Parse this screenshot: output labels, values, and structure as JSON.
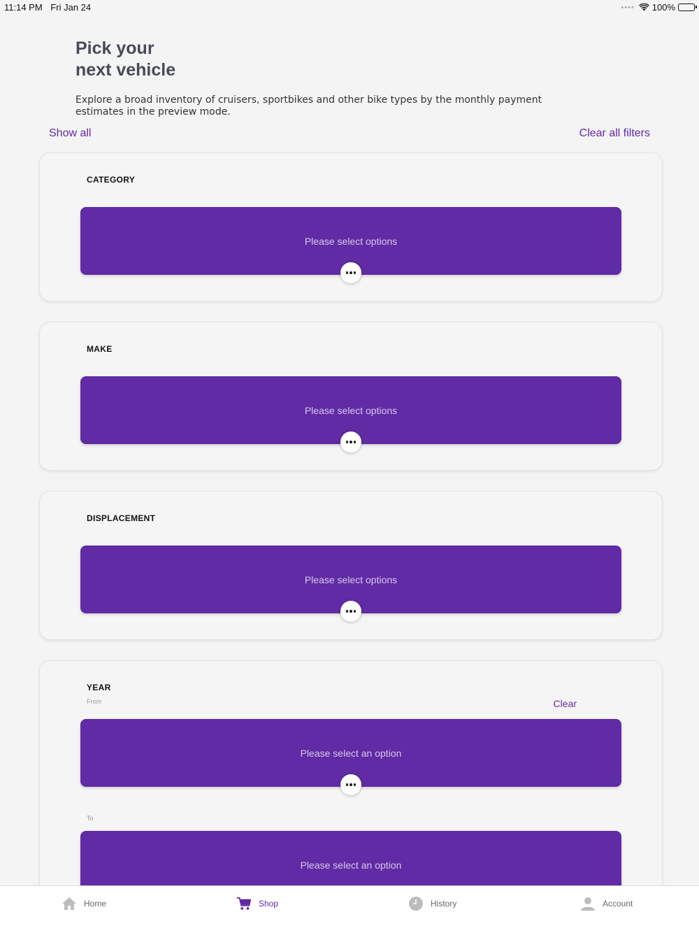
{
  "status_bar": {
    "time": "11:14 PM",
    "date": "Fri Jan 24",
    "battery": "100%"
  },
  "header": {
    "title": "Pick your\nnext vehicle",
    "description": "Explore a broad inventory of cruisers, sportbikes and other bike types by the monthly payment estimates in the preview mode."
  },
  "filters_bar": {
    "show_all": "Show all",
    "clear_all": "Clear all filters"
  },
  "sections": {
    "category": {
      "title": "CATEGORY",
      "placeholder": "Please select options"
    },
    "make": {
      "title": "MAKE",
      "placeholder": "Please select options"
    },
    "displacement": {
      "title": "DISPLACEMENT",
      "placeholder": "Please select options"
    },
    "year": {
      "title": "YEAR",
      "clear": "Clear",
      "from_label": "From",
      "from_placeholder": "Please select an option",
      "to_label": "To",
      "to_placeholder": "Please select an option"
    }
  },
  "tabs": {
    "home": "Home",
    "shop": "Shop",
    "history": "History",
    "account": "Account"
  },
  "colors": {
    "accent": "#5f2aa4",
    "select_bg": "#602ba4",
    "title_text": "#464b55"
  }
}
